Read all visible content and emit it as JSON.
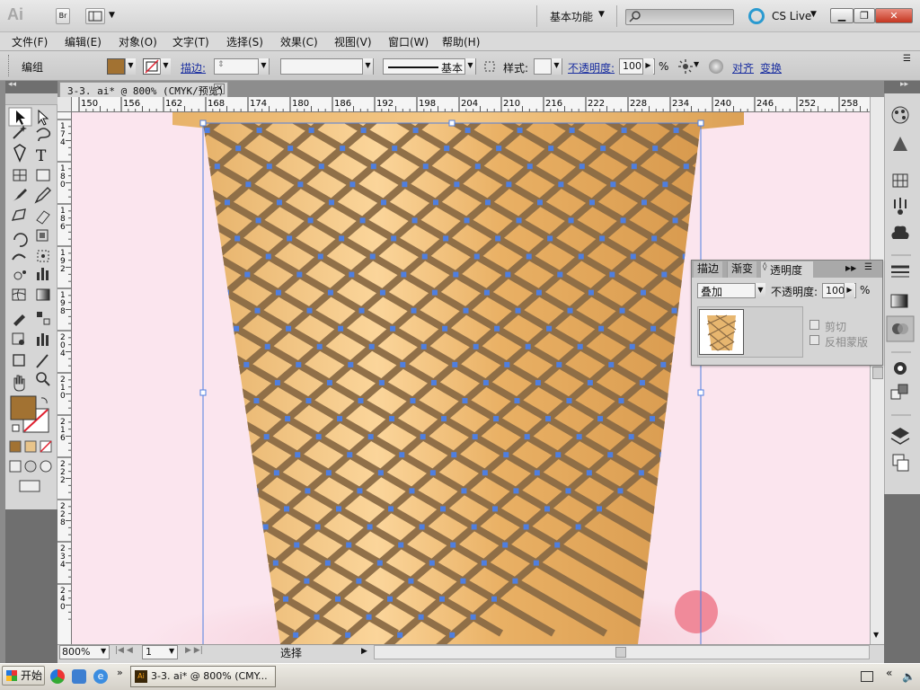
{
  "app": {
    "logo": "Ai",
    "bridge_label": "Br",
    "workspace_label": "基本功能",
    "cslive_label": "CS Live",
    "window_controls": [
      "minimize-icon",
      "maximize-icon",
      "close-icon"
    ]
  },
  "menu": {
    "items": [
      "文件(F)",
      "编辑(E)",
      "对象(O)",
      "文字(T)",
      "选择(S)",
      "效果(C)",
      "视图(V)",
      "窗口(W)",
      "帮助(H)"
    ]
  },
  "control": {
    "group_label": "编组",
    "stroke_label": "描边:",
    "stroke_style_label": "基本",
    "style_label": "样式:",
    "opacity_label": "不透明度:",
    "opacity_value": "100",
    "opacity_unit": "%",
    "align_label": "对齐",
    "transform_label": "变换",
    "fill_color": "#a27232"
  },
  "document": {
    "tab_title": "3-3. ai* @ 800% (CMYK/预览)"
  },
  "rulers": {
    "h_ticks": [
      "150",
      "156",
      "162",
      "168",
      "174",
      "180",
      "186",
      "192",
      "198",
      "204",
      "210",
      "216",
      "222",
      "228",
      "234",
      "240",
      "246",
      "252",
      "258"
    ],
    "v_ticks": [
      "174",
      "180",
      "186",
      "192",
      "198",
      "204",
      "210",
      "216",
      "222",
      "228",
      "234",
      "240"
    ]
  },
  "status": {
    "zoom": "800%",
    "page": "1",
    "mode": "选择"
  },
  "transparency_panel": {
    "tabs": [
      "描边",
      "渐变",
      "透明度"
    ],
    "active_tab": "透明度",
    "blend_mode": "叠加",
    "opacity_label": "不透明度:",
    "opacity_value": "100",
    "opacity_unit": "%",
    "clip_label": "剪切",
    "invert_mask_label": "反相蒙版"
  },
  "taskbar": {
    "start_label": "开始",
    "task_label": "3-3. ai* @ 800% (CMY..."
  }
}
